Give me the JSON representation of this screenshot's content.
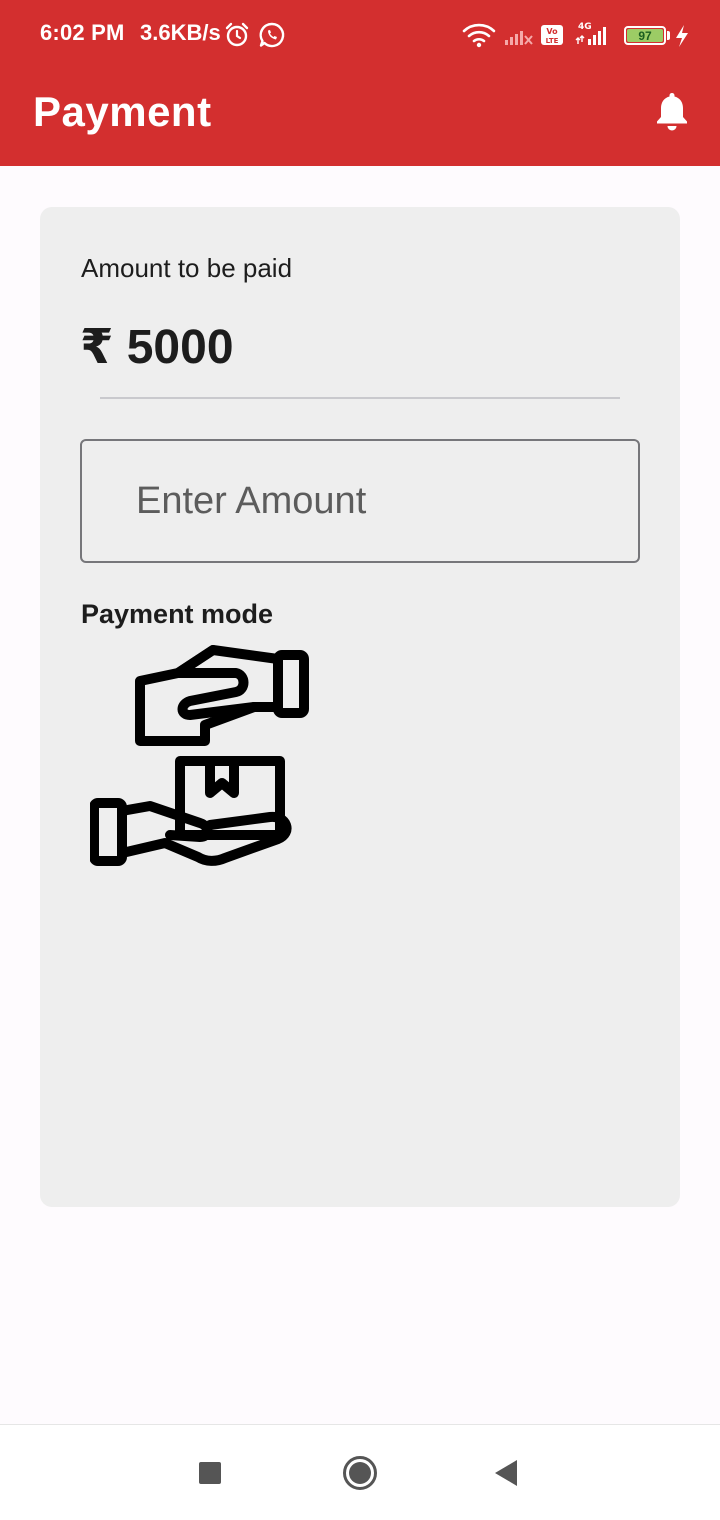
{
  "status_bar": {
    "time": "6:02 PM",
    "net_speed": "3.6KB/s",
    "battery_level": "97",
    "icons": [
      "alarm-icon",
      "whatsapp-icon",
      "wifi-icon",
      "signal-icon",
      "volte-icon",
      "signal-4g-icon",
      "battery-icon",
      "charging-icon"
    ]
  },
  "header": {
    "title": "Payment",
    "notification_icon": "bell-icon"
  },
  "payment_card": {
    "amount_label": "Amount to be paid",
    "amount_value": "₹ 5000",
    "amount_input_placeholder": "Enter Amount",
    "payment_mode_label": "Payment mode",
    "payment_mode_icon": "cash-on-delivery-icon"
  },
  "nav_bar": {
    "icons": [
      "recents-icon",
      "home-icon",
      "back-icon"
    ]
  },
  "colors": {
    "primary": "#d32f2f",
    "card_background": "#eeeeee",
    "page_background": "#fefbfe",
    "text": "#1d1d1d"
  }
}
